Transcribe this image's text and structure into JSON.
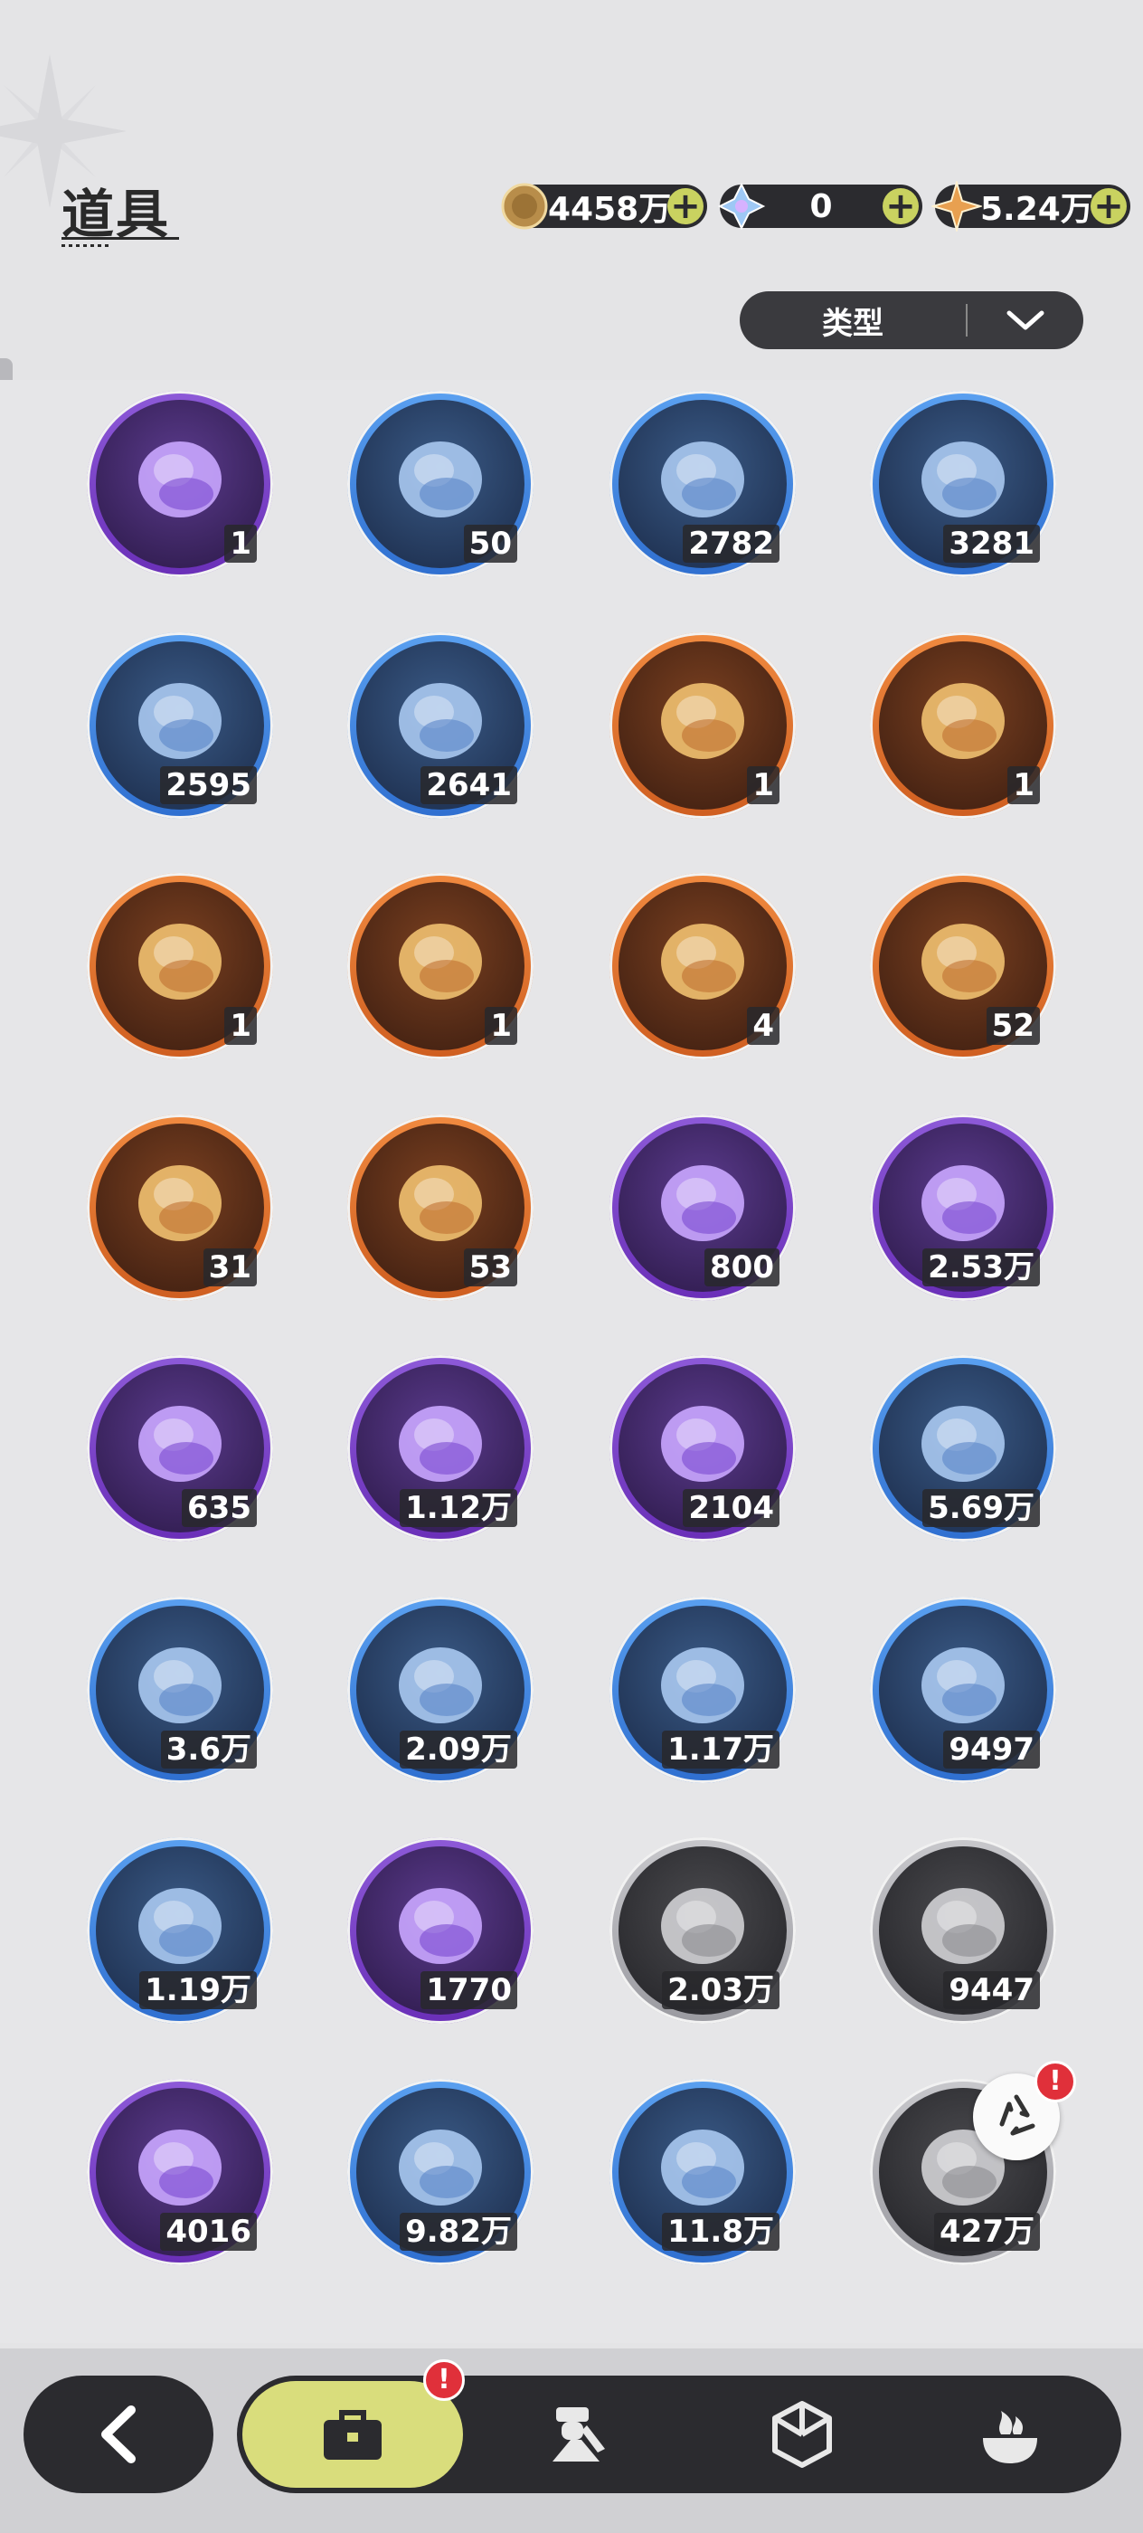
{
  "header": {
    "title": "道具",
    "currencies": [
      {
        "name": "coin-icon",
        "value": "4458万"
      },
      {
        "name": "crystal-icon",
        "value": "0"
      },
      {
        "name": "star-shard-icon",
        "value": "5.24万"
      }
    ]
  },
  "filter": {
    "label": "类型"
  },
  "items": [
    {
      "icon": "book-icon",
      "rarity": "purple",
      "count": "1"
    },
    {
      "icon": "envelope-icon",
      "rarity": "blue",
      "count": "50"
    },
    {
      "icon": "shovel-icon",
      "rarity": "blue",
      "count": "2782"
    },
    {
      "icon": "gauntlet-icon",
      "rarity": "blue",
      "count": "3281"
    },
    {
      "icon": "pickaxe-icon",
      "rarity": "blue",
      "count": "2595"
    },
    {
      "icon": "hammers-icon",
      "rarity": "blue",
      "count": "2641"
    },
    {
      "icon": "spiked-hammer-icon",
      "rarity": "orange",
      "count": "1"
    },
    {
      "icon": "cloud-icon",
      "rarity": "orange",
      "count": "1"
    },
    {
      "icon": "spiked-ball-icon",
      "rarity": "orange",
      "count": "1"
    },
    {
      "icon": "drill-icon",
      "rarity": "orange",
      "count": "1"
    },
    {
      "icon": "key-icon",
      "rarity": "orange",
      "count": "4"
    },
    {
      "icon": "heart-gem-icon",
      "rarity": "orange",
      "count": "52"
    },
    {
      "icon": "shirt-coin-icon",
      "rarity": "orange",
      "count": "31"
    },
    {
      "icon": "ticket-icon",
      "rarity": "orange",
      "count": "53"
    },
    {
      "icon": "medal-icon",
      "rarity": "purple",
      "count": "800"
    },
    {
      "icon": "star-coin-icon",
      "rarity": "purple",
      "count": "2.53万"
    },
    {
      "icon": "fist-coin-icon",
      "rarity": "purple",
      "count": "635"
    },
    {
      "icon": "blue-coin-icon",
      "rarity": "purple",
      "count": "1.12万"
    },
    {
      "icon": "heart-coin-icon",
      "rarity": "purple",
      "count": "2104"
    },
    {
      "icon": "bunny-card-icon",
      "rarity": "blue",
      "count": "5.69万"
    },
    {
      "icon": "silver-coin-icon",
      "rarity": "blue",
      "count": "3.6万"
    },
    {
      "icon": "claw-icon",
      "rarity": "blue",
      "count": "2.09万"
    },
    {
      "icon": "scale-icon",
      "rarity": "blue",
      "count": "1.17万"
    },
    {
      "icon": "gear-icon",
      "rarity": "blue",
      "count": "9497"
    },
    {
      "icon": "leaf-icon",
      "rarity": "blue",
      "count": "1.19万"
    },
    {
      "icon": "knot-charm-icon",
      "rarity": "purple",
      "count": "1770"
    },
    {
      "icon": "logs-icon",
      "rarity": "grey",
      "count": "2.03万"
    },
    {
      "icon": "stone-blocks-icon",
      "rarity": "grey",
      "count": "9447"
    },
    {
      "icon": "gold-crystal-icon",
      "rarity": "purple",
      "count": "4016"
    },
    {
      "icon": "gold-dust-icon",
      "rarity": "blue",
      "count": "9.82万"
    },
    {
      "icon": "red-crystal-icon",
      "rarity": "blue",
      "count": "11.8万"
    },
    {
      "icon": "sand-pile-icon",
      "rarity": "grey",
      "count": "427万"
    }
  ],
  "badges": {
    "recycle": "!",
    "bag_tab": "!"
  },
  "nav": [
    "bag-icon",
    "character-icon",
    "hexagon-icon",
    "cooking-icon"
  ]
}
